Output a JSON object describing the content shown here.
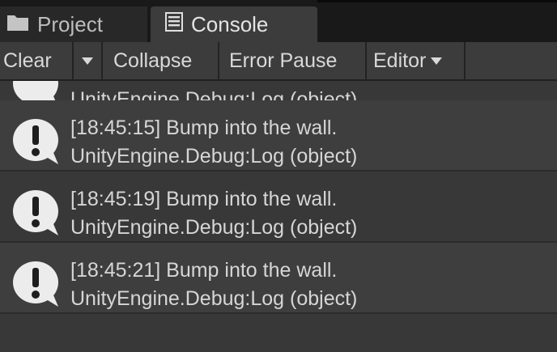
{
  "tabs": [
    {
      "label": "Project",
      "icon": "folder-icon",
      "active": false
    },
    {
      "label": "Console",
      "icon": "console-icon",
      "active": true
    }
  ],
  "toolbar": {
    "clear_label": "Clear",
    "collapse_label": "Collapse",
    "error_pause_label": "Error Pause",
    "editor_label": "Editor"
  },
  "log": {
    "partial_line": "UnityEngine.Debug:Log (object)",
    "entries": [
      {
        "message": "[18:45:15] Bump into the wall.",
        "stack": "UnityEngine.Debug:Log (object)",
        "icon": "info-message-icon"
      },
      {
        "message": "[18:45:19] Bump into the wall.",
        "stack": "UnityEngine.Debug:Log (object)",
        "icon": "info-message-icon"
      },
      {
        "message": "[18:45:21] Bump into the wall.",
        "stack": "UnityEngine.Debug:Log (object)",
        "icon": "info-message-icon"
      }
    ]
  },
  "colors": {
    "background": "#383838",
    "toolbar": "#3c3c3c",
    "tab_bar": "#191919",
    "text": "#d6d6d6"
  }
}
